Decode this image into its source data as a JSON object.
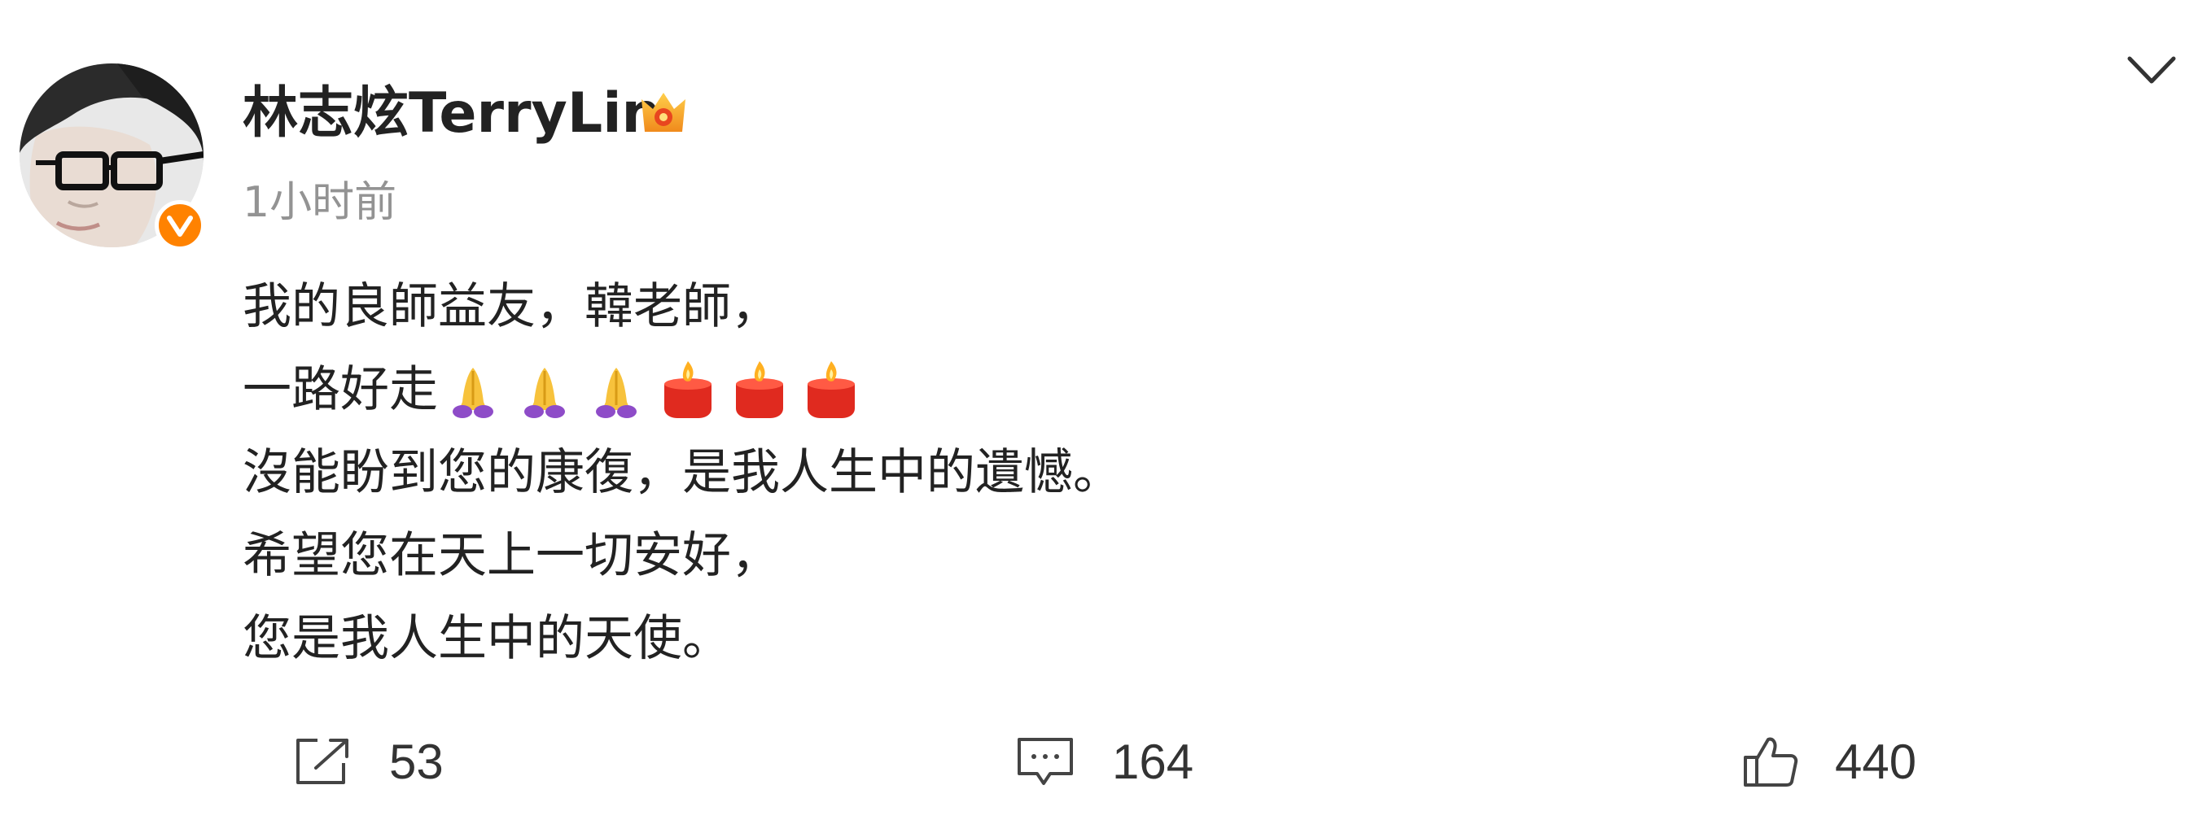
{
  "author": {
    "name": "林志炫TerryLin",
    "avatar_icon": "avatar",
    "verified_icon": "verified-v-icon",
    "verified_color": "#ff8200",
    "vip_icon": "vip-crown-icon"
  },
  "post": {
    "timestamp": "1小时前",
    "lines": [
      "我的良師益友，韓老師，",
      "一路好走",
      "沒能盼到您的康復，是我人生中的遺憾。",
      "希望您在天上一切安好，",
      "您是我人生中的天使。"
    ],
    "emojis": [
      "pray-icon",
      "pray-icon",
      "pray-icon",
      "candle-icon",
      "candle-icon",
      "candle-icon"
    ]
  },
  "actions": {
    "repost": {
      "icon": "repost-icon",
      "count": "53"
    },
    "comment": {
      "icon": "comment-icon",
      "count": "164"
    },
    "like": {
      "icon": "thumbs-up-icon",
      "count": "440"
    }
  },
  "menu_icon": "chevron-down-icon"
}
